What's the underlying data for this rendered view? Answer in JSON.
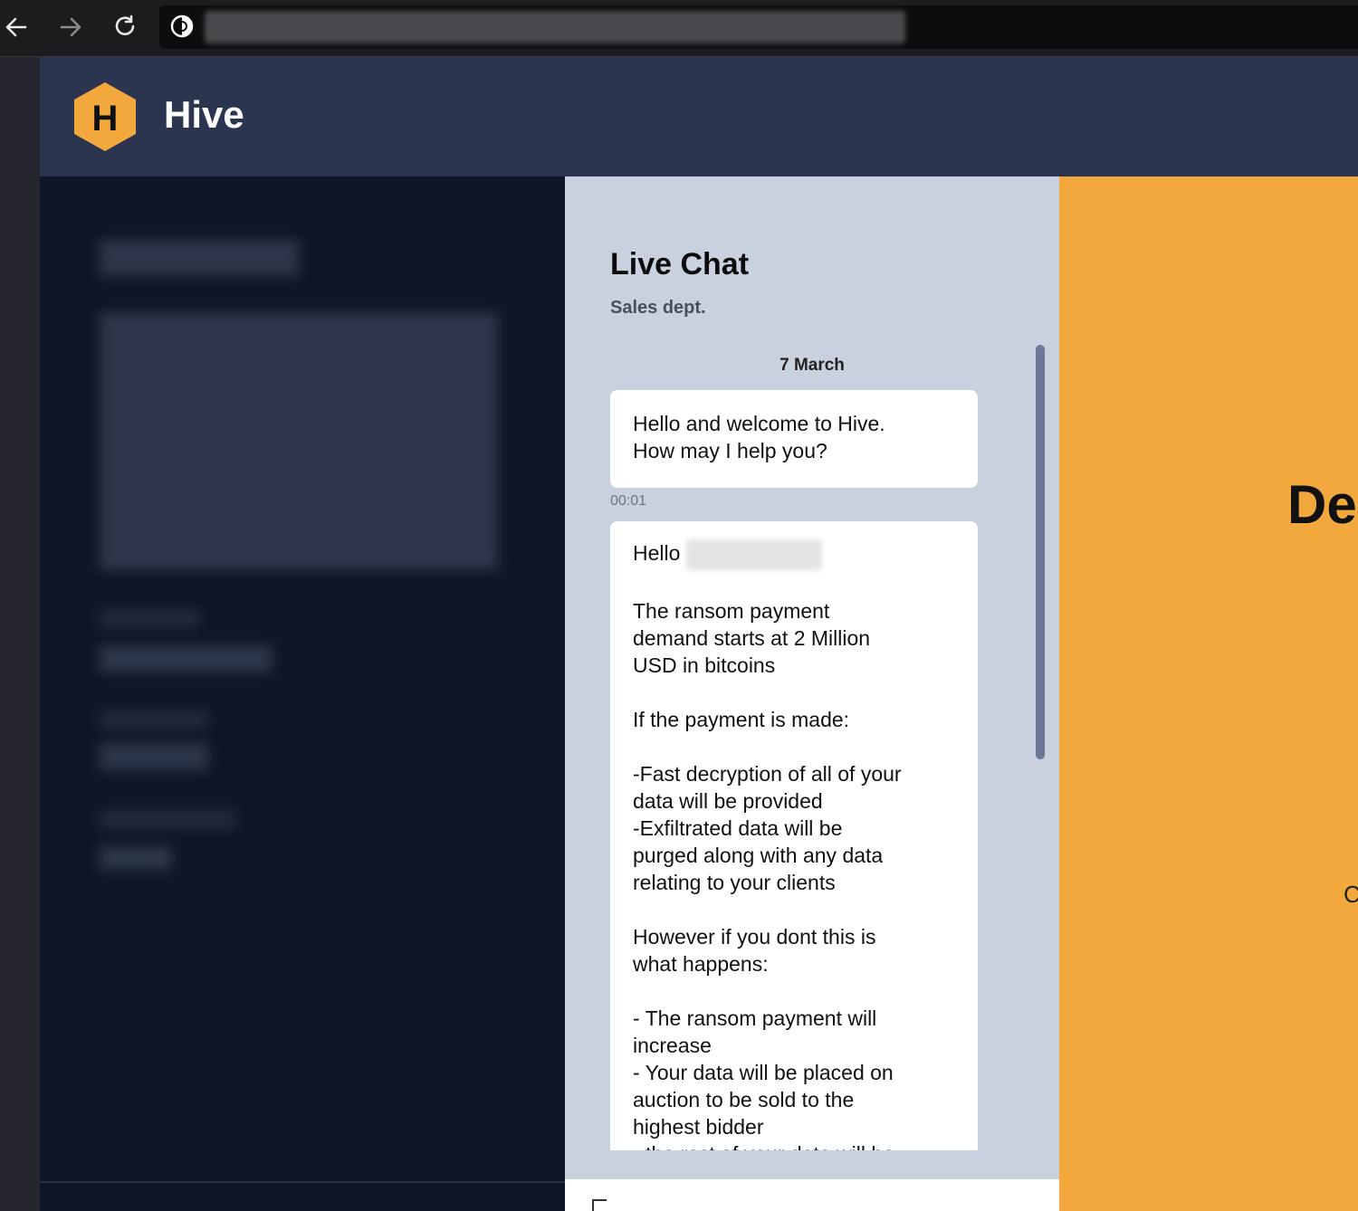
{
  "browser": {
    "back_icon": "arrow-left-icon",
    "forward_icon": "arrow-right-icon",
    "reload_icon": "reload-icon",
    "site_icon": "tor-onion-icon",
    "url": ""
  },
  "header": {
    "logo_letter": "H",
    "brand": "Hive",
    "logo_color": "#f2a83c"
  },
  "chat": {
    "title": "Live Chat",
    "subtitle": "Sales dept.",
    "date": "7 March",
    "messages": [
      {
        "text": "Hello and welcome to Hive.\nHow may I help you?",
        "time": "00:01"
      },
      {
        "greeting": "Hello",
        "text": "The ransom payment\ndemand starts at 2 Million\nUSD in bitcoins\n\nIf the payment is made:\n\n-Fast decryption of all of your\ndata will be provided\n-Exfiltrated data will be\npurged along with any data\nrelating to your clients\n\nHowever if you dont this is\nwhat happens:\n\n- The ransom payment will\nincrease\n- Your data will be placed on\nauction to be sold to the\nhighest bidder\n- the rest of your data will be"
      }
    ]
  },
  "right_panel": {
    "heading": "De",
    "letter": "C"
  },
  "colors": {
    "header_bg": "#2c354f",
    "left_bg": "#0f1629",
    "chat_bg": "#c9d1df",
    "accent": "#f2a83c"
  }
}
